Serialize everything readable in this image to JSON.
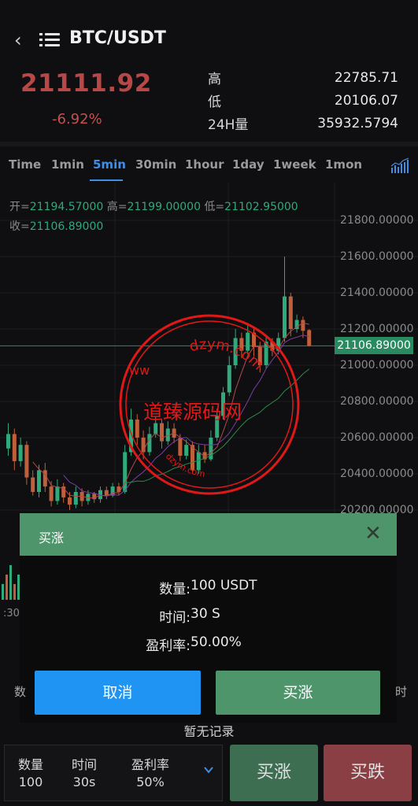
{
  "header": {
    "back_icon": "chevron-left-icon",
    "menu_icon": "list-icon",
    "pair": "BTC/USDT"
  },
  "ticker": {
    "price": "21111.92",
    "change": "-6.92%",
    "high_label": "高",
    "high_value": "22785.71",
    "low_label": "低",
    "low_value": "20106.07",
    "vol_label": "24H量",
    "vol_value": "35932.5794"
  },
  "tabs": [
    {
      "label": "Time"
    },
    {
      "label": "1min"
    },
    {
      "label": "5min",
      "active": true
    },
    {
      "label": "30min"
    },
    {
      "label": "1hour"
    },
    {
      "label": "1day"
    },
    {
      "label": "1week"
    },
    {
      "label": "1mon"
    }
  ],
  "chart_data": {
    "type": "candlestick",
    "ohlc": {
      "open_label": "开=",
      "open": "21194.57000",
      "high_label": "高=",
      "high": "21199.00000",
      "low_label": "低=",
      "low": "21102.95000",
      "close_label": "收=",
      "close": "21106.89000"
    },
    "y_ticks": [
      "21800.00000",
      "21600.00000",
      "21400.00000",
      "21200.00000",
      "21000.00000",
      "20800.00000",
      "20600.00000",
      "20400.00000",
      "20200.00000"
    ],
    "current_price_label": "21106.89000",
    "time_label": ":30",
    "colors": {
      "up": "#2eaa7b",
      "down": "#c0603a",
      "ma1": "#b04a4a",
      "ma2": "#7a3ea0",
      "ma3": "#2a8a4a"
    }
  },
  "watermark": {
    "text_cn": "道臻源码网",
    "text_url_top": "dzym.com",
    "text_url_bottom": "dzym.com",
    "left_ww": "ww",
    "color": "#e01818"
  },
  "modal": {
    "title": "买涨",
    "close_icon": "close-icon",
    "qty_label": "数量:",
    "qty_value": "100 USDT",
    "time_label": "时间:",
    "time_value": "30 S",
    "rate_label": "盈利率:",
    "rate_value": "50.00%",
    "cancel_label": "取消",
    "confirm_label": "买涨"
  },
  "behind": {
    "left_text": "数",
    "right_text": "时",
    "empty_text": "暂无记录"
  },
  "bottom": {
    "qty_label": "数量",
    "qty_value": "100",
    "time_label": "时间",
    "time_value": "30s",
    "rate_label": "盈利率",
    "rate_value": "50%",
    "expand_icon": "chevron-down-icon",
    "buy_up_label": "买涨",
    "buy_down_label": "买跌"
  }
}
